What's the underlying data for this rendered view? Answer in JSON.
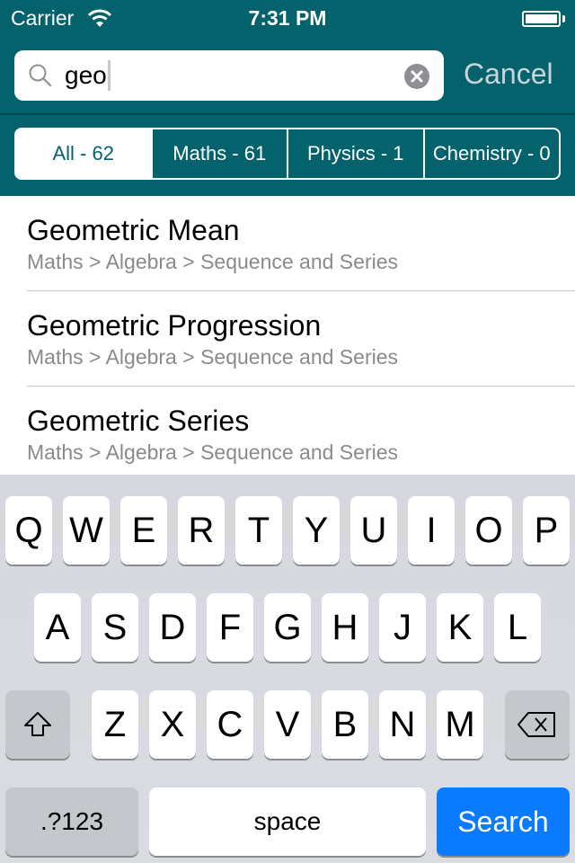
{
  "status_bar": {
    "carrier": "Carrier",
    "time": "7:31 PM",
    "wifi_icon": "wifi-icon",
    "battery_icon": "battery-icon"
  },
  "search": {
    "value": "geo",
    "placeholder": "",
    "cancel_label": "Cancel",
    "search_icon": "search-icon",
    "clear_icon": "clear-icon"
  },
  "filters": [
    {
      "label": "All - 62",
      "active": true
    },
    {
      "label": "Maths - 61",
      "active": false
    },
    {
      "label": "Physics - 1",
      "active": false
    },
    {
      "label": "Chemistry - 0",
      "active": false
    }
  ],
  "results": [
    {
      "title": "Geometric Mean",
      "path": "Maths > Algebra > Sequence and Series"
    },
    {
      "title": "Geometric Progression",
      "path": "Maths > Algebra > Sequence and Series"
    },
    {
      "title": "Geometric Series",
      "path": "Maths > Algebra > Sequence and Series"
    }
  ],
  "keyboard": {
    "row1": [
      "Q",
      "W",
      "E",
      "R",
      "T",
      "Y",
      "U",
      "I",
      "O",
      "P"
    ],
    "row2": [
      "A",
      "S",
      "D",
      "F",
      "G",
      "H",
      "J",
      "K",
      "L"
    ],
    "row3": [
      "Z",
      "X",
      "C",
      "V",
      "B",
      "N",
      "M"
    ],
    "shift_icon": "shift-icon",
    "delete_icon": "delete-icon",
    "numbers_label": ".?123",
    "space_label": "space",
    "search_label": "Search"
  },
  "colors": {
    "header": "#03626C",
    "search_key": "#0A7AFF"
  }
}
